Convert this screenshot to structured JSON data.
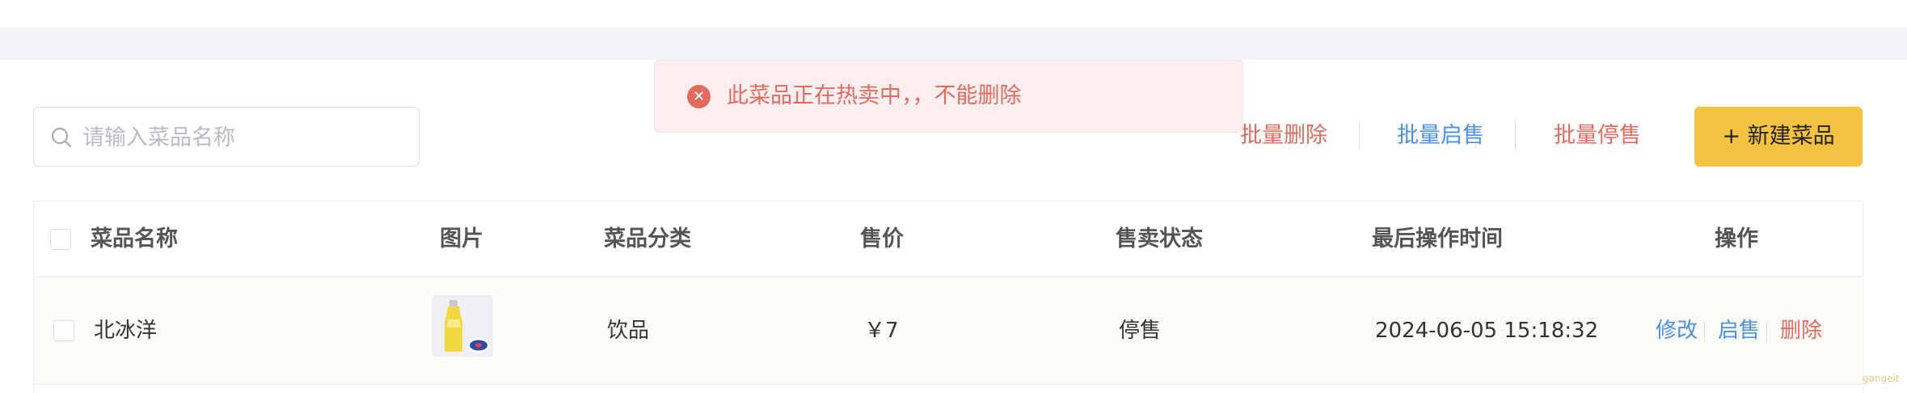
{
  "search": {
    "placeholder": "请输入菜品名称",
    "value": ""
  },
  "toolbar": {
    "batch_delete": "批量删除",
    "batch_enable": "批量启售",
    "batch_disable": "批量停售",
    "new_dish": "+ 新建菜品"
  },
  "table": {
    "headers": [
      "菜品名称",
      "图片",
      "菜品分类",
      "售价",
      "售卖状态",
      "最后操作时间",
      "操作"
    ],
    "rows": [
      {
        "name": "北冰洋",
        "category": "饮品",
        "price": "￥7",
        "status": "停售",
        "updated": "2024-06-05 15:18:32",
        "actions": [
          "修改",
          "启售",
          "删除"
        ]
      }
    ]
  },
  "toast": {
    "message": "此菜品正在热卖中，，不能删除",
    "type": "error"
  },
  "watermark": "gangeit",
  "colors": {
    "accent": "#f5c241",
    "danger": "#e26b5f",
    "link": "#4a90e8",
    "toast_bg": "#fdefef"
  }
}
